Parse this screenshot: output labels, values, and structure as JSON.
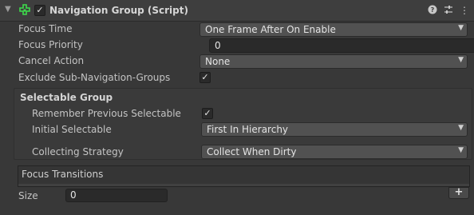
{
  "component": {
    "title": "Navigation Group (Script)",
    "enabled_check": "✓",
    "icons": [
      "fold-arrow-icon",
      "navigation-component-icon",
      "help-icon",
      "preset-icon",
      "context-menu-icon"
    ]
  },
  "properties": {
    "focus_time": {
      "label": "Focus Time",
      "value": "One Frame After On Enable"
    },
    "focus_priority": {
      "label": "Focus Priority",
      "value": "0"
    },
    "cancel_action": {
      "label": "Cancel Action",
      "value": "None"
    },
    "exclude_sub": {
      "label": "Exclude Sub-Navigation-Groups",
      "check": "✓"
    }
  },
  "selectable_group": {
    "title": "Selectable Group",
    "remember_previous": {
      "label": "Remember Previous Selectable",
      "check": "✓"
    },
    "initial_selectable": {
      "label": "Initial Selectable",
      "value": "First In Hierarchy"
    },
    "collecting_strategy": {
      "label": "Collecting Strategy",
      "value": "Collect When Dirty"
    }
  },
  "focus_transitions": {
    "title": "Focus Transitions",
    "size_label": "Size",
    "size_value": "0",
    "add_label": "+"
  },
  "colors": {
    "background": "#383838",
    "accent_icon": "#3ddc4b"
  }
}
